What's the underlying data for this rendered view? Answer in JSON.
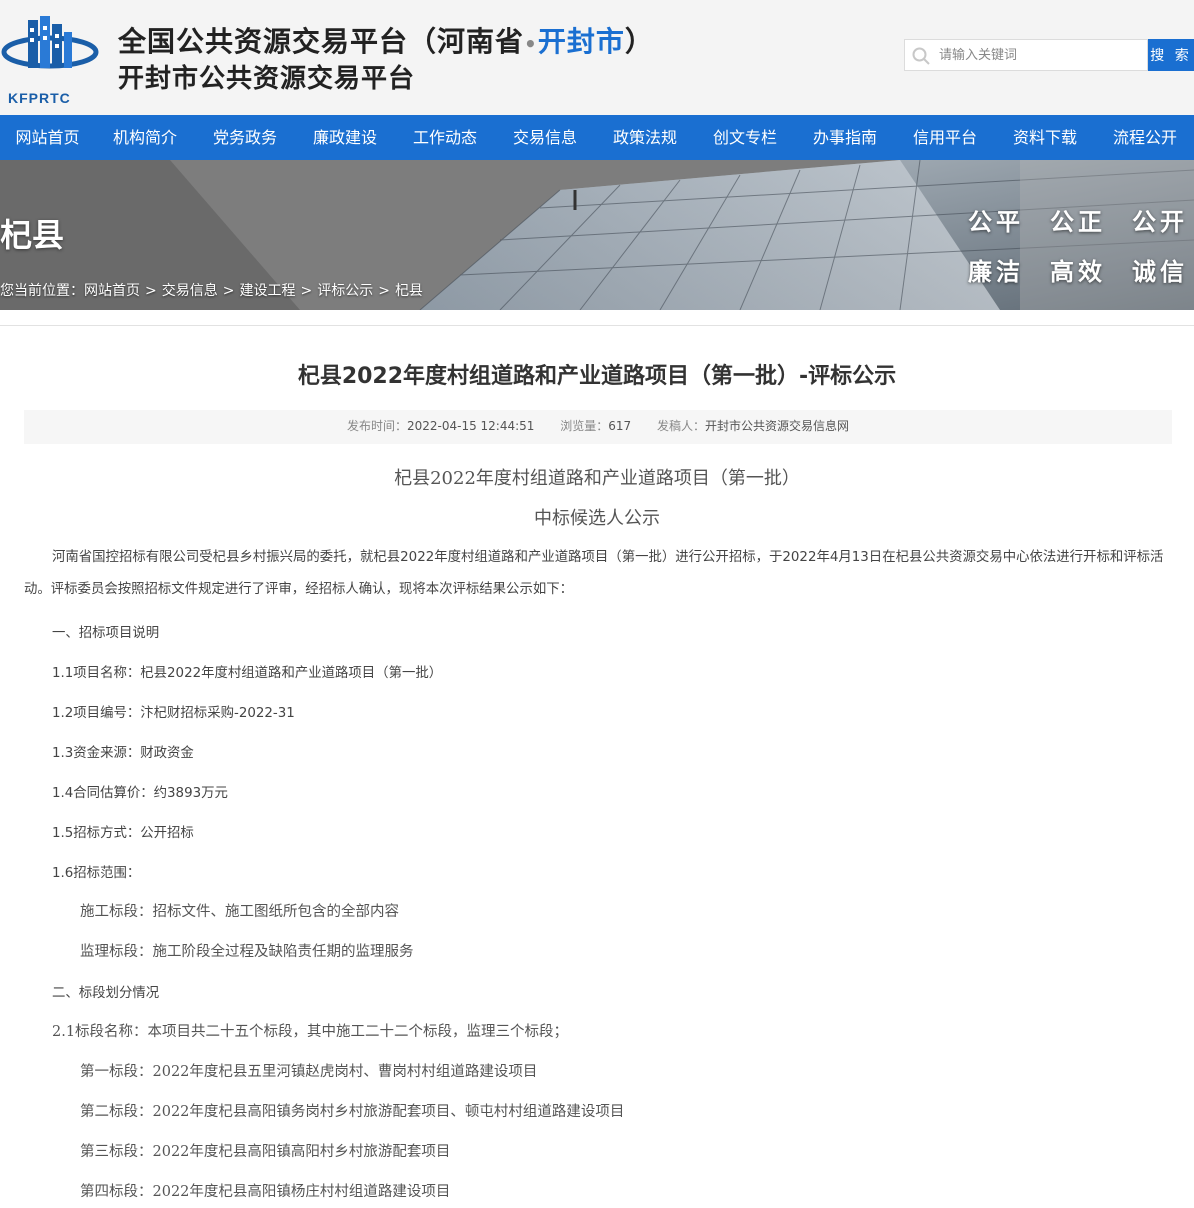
{
  "header": {
    "logo_text": "KFPRTC",
    "title_prefix": "全国公共资源交易平台（河南省",
    "title_dot": "•",
    "title_city": "开封市",
    "title_suffix": "）",
    "subtitle": "开封市公共资源交易平台",
    "search_placeholder": "请输入关键词",
    "search_button": "搜 索"
  },
  "nav": [
    "网站首页",
    "机构简介",
    "党务政务",
    "廉政建设",
    "工作动态",
    "交易信息",
    "政策法规",
    "创文专栏",
    "办事指南",
    "信用平台",
    "资料下载",
    "流程公开"
  ],
  "banner": {
    "title": "杞县",
    "breadcrumb_prefix": "您当前位置：",
    "breadcrumb": [
      "网站首页",
      "交易信息",
      "建设工程",
      "评标公示",
      "杞县"
    ],
    "breadcrumb_sep": ">",
    "slogan_row1": [
      "公平",
      "公正",
      "公开"
    ],
    "slogan_row2": [
      "廉洁",
      "高效",
      "诚信"
    ]
  },
  "article": {
    "title": "杞县2022年度村组道路和产业道路项目（第一批）-评标公示",
    "publish_label": "发布时间：",
    "publish_time": "2022-04-15 12:44:51",
    "views_label": "浏览量：",
    "views": "617",
    "author_label": "发稿人：",
    "author": "开封市公共资源交易信息网",
    "doc_title1": "杞县2022年度村组道路和产业道路项目（第一批）",
    "doc_title2": "中标候选人公示",
    "intro": "河南省国控招标有限公司受杞县乡村振兴局的委托，就杞县2022年度村组道路和产业道路项目（第一批）进行公开招标，于2022年4月13日在杞县公共资源交易中心依法进行开标和评标活动。评标委员会按照招标文件规定进行了评审，经招标人确认，现将本次评标结果公示如下：",
    "lines": [
      "一、招标项目说明",
      "1.1项目名称：杞县2022年度村组道路和产业道路项目（第一批）",
      "1.2项目编号：汴杞财招标采购-2022-31",
      "1.3资金来源：财政资金",
      "1.4合同估算价：约3893万元",
      "1.5招标方式：公开招标",
      "1.6招标范围：",
      "施工标段：招标文件、施工图纸所包含的全部内容",
      "监理标段：施工阶段全过程及缺陷责任期的监理服务",
      "二、标段划分情况",
      "2.1标段名称：本项目共二十五个标段，其中施工二十二个标段，监理三个标段；",
      "第一标段：2022年度杞县五里河镇赵虎岗村、曹岗村村组道路建设项目",
      "第二标段：2022年度杞县高阳镇务岗村乡村旅游配套项目、顿屯村村组道路建设项目",
      "第三标段：2022年度杞县高阳镇高阳村乡村旅游配套项目",
      "第四标段：2022年度杞县高阳镇杨庄村村组道路建设项目"
    ]
  },
  "colors": {
    "brand_blue": "#1a6fd1",
    "logo_blue": "#1a5ea8"
  }
}
